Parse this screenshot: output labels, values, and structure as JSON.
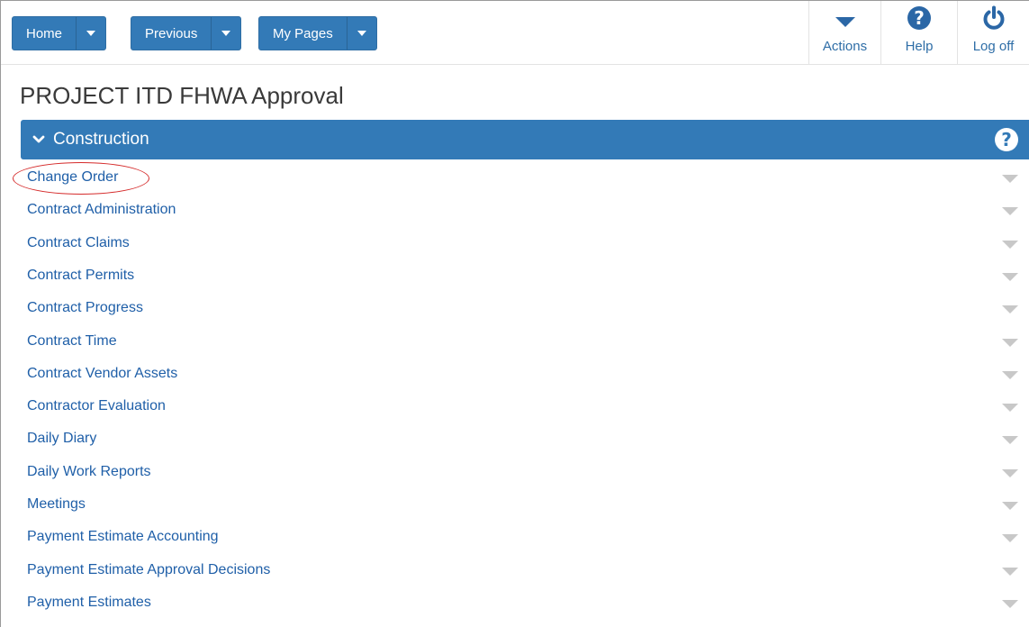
{
  "nav": {
    "home_label": "Home",
    "previous_label": "Previous",
    "mypages_label": "My Pages"
  },
  "toolbar": {
    "actions_label": "Actions",
    "help_label": "Help",
    "logoff_label": "Log off"
  },
  "page": {
    "title": "PROJECT ITD FHWA Approval"
  },
  "section": {
    "title": "Construction"
  },
  "items": [
    {
      "label": "Change Order"
    },
    {
      "label": "Contract Administration"
    },
    {
      "label": "Contract Claims"
    },
    {
      "label": "Contract Permits"
    },
    {
      "label": "Contract Progress"
    },
    {
      "label": "Contract Time"
    },
    {
      "label": "Contract Vendor Assets"
    },
    {
      "label": "Contractor Evaluation"
    },
    {
      "label": "Daily Diary"
    },
    {
      "label": "Daily Work Reports"
    },
    {
      "label": "Meetings"
    },
    {
      "label": "Payment Estimate Accounting"
    },
    {
      "label": "Payment Estimate Approval Decisions"
    },
    {
      "label": "Payment Estimates"
    }
  ],
  "colors": {
    "primary": "#337ab7",
    "link": "#1f5fa8",
    "highlight_circle": "#d52b2b"
  }
}
